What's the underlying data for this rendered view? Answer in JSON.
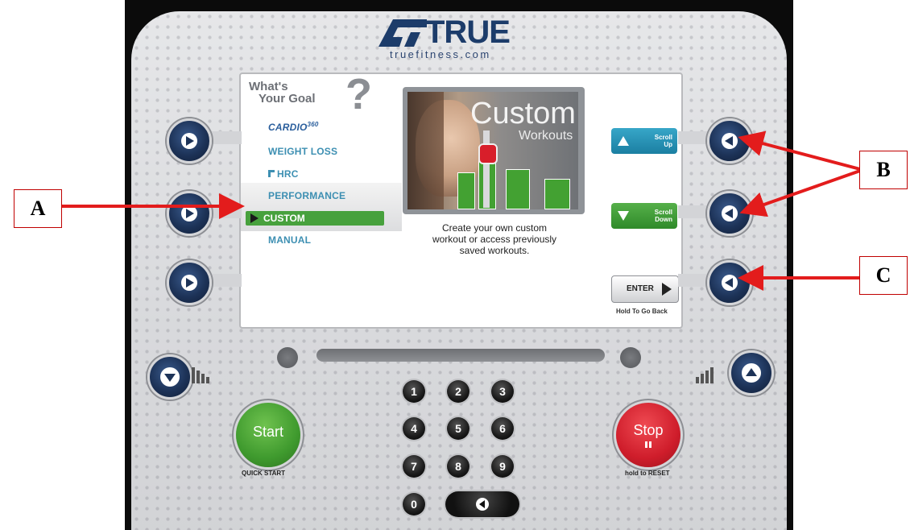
{
  "brand": {
    "name": "TRUE",
    "url": "truefitness.com"
  },
  "screen": {
    "heading_line1": "What's",
    "heading_line2": "Your Goal",
    "heading_mark": "?",
    "menu": [
      {
        "label": "CARDIO",
        "sup": "360"
      },
      {
        "label": "WEIGHT LOSS"
      },
      {
        "label": "HRC"
      },
      {
        "label": "PERFORMANCE"
      },
      {
        "label": "CUSTOM",
        "selected": true
      },
      {
        "label": "MANUAL"
      }
    ],
    "preview": {
      "title": "Custom",
      "subtitle": "Workouts"
    },
    "description": [
      "Create your own custom",
      "workout or access previously",
      "saved workouts."
    ],
    "scroll_up": {
      "line1": "Scroll",
      "line2": "Up"
    },
    "scroll_down": {
      "line1": "Scroll",
      "line2": "Down"
    },
    "enter": {
      "label": "ENTER",
      "sub": "Hold To Go Back"
    }
  },
  "keypad": {
    "keys": [
      "1",
      "2",
      "3",
      "4",
      "5",
      "6",
      "7",
      "8",
      "9",
      "0"
    ]
  },
  "start": {
    "label": "Start",
    "sub": "QUICK START"
  },
  "stop": {
    "label": "Stop",
    "sub": "hold to RESET"
  },
  "callouts": {
    "a": "A",
    "b": "B",
    "c": "C"
  },
  "colors": {
    "arrow": "#e31c1c",
    "accent_green": "#3f9a36",
    "accent_teal": "#1e8fb0",
    "button_navy": "#1d3358",
    "start_green": "#4aa23a",
    "stop_red": "#d81e2a"
  }
}
